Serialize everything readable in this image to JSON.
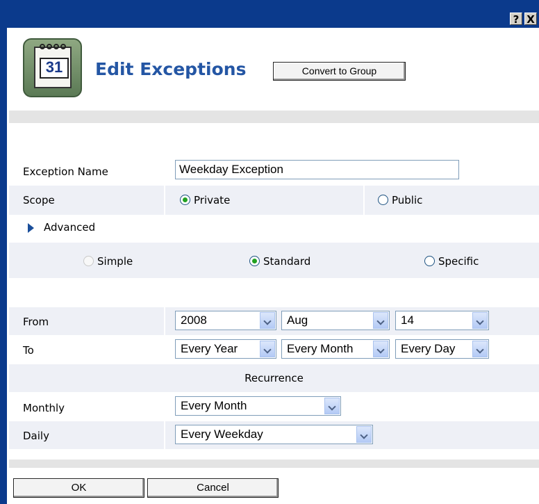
{
  "titlebar": {
    "help_label": "?",
    "close_label": "X"
  },
  "header": {
    "title": "Edit Exceptions",
    "convert_button": "Convert to Group",
    "logo_number": "31"
  },
  "form": {
    "exception_name_label": "Exception Name",
    "exception_name_value": "Weekday Exception",
    "scope_label": "Scope",
    "scope_private": "Private",
    "scope_public": "Public",
    "scope_selected": "Private",
    "advanced_label": "Advanced",
    "mode_simple": "Simple",
    "mode_standard": "Standard",
    "mode_specific": "Specific",
    "mode_selected": "Standard",
    "from_label": "From",
    "from_year": "2008",
    "from_month": "Aug",
    "from_day": "14",
    "to_label": "To",
    "to_year": "Every Year",
    "to_month": "Every Month",
    "to_day": "Every Day",
    "recurrence_heading": "Recurrence",
    "monthly_label": "Monthly",
    "monthly_value": "Every Month",
    "daily_label": "Daily",
    "daily_value": "Every Weekday"
  },
  "footer": {
    "ok_button": "OK",
    "cancel_button": "Cancel"
  },
  "colors": {
    "titlebar": "#0b3a8c",
    "title_text": "#2456a4",
    "row_shade": "#eef0f6",
    "radio_dot": "#21a121"
  }
}
